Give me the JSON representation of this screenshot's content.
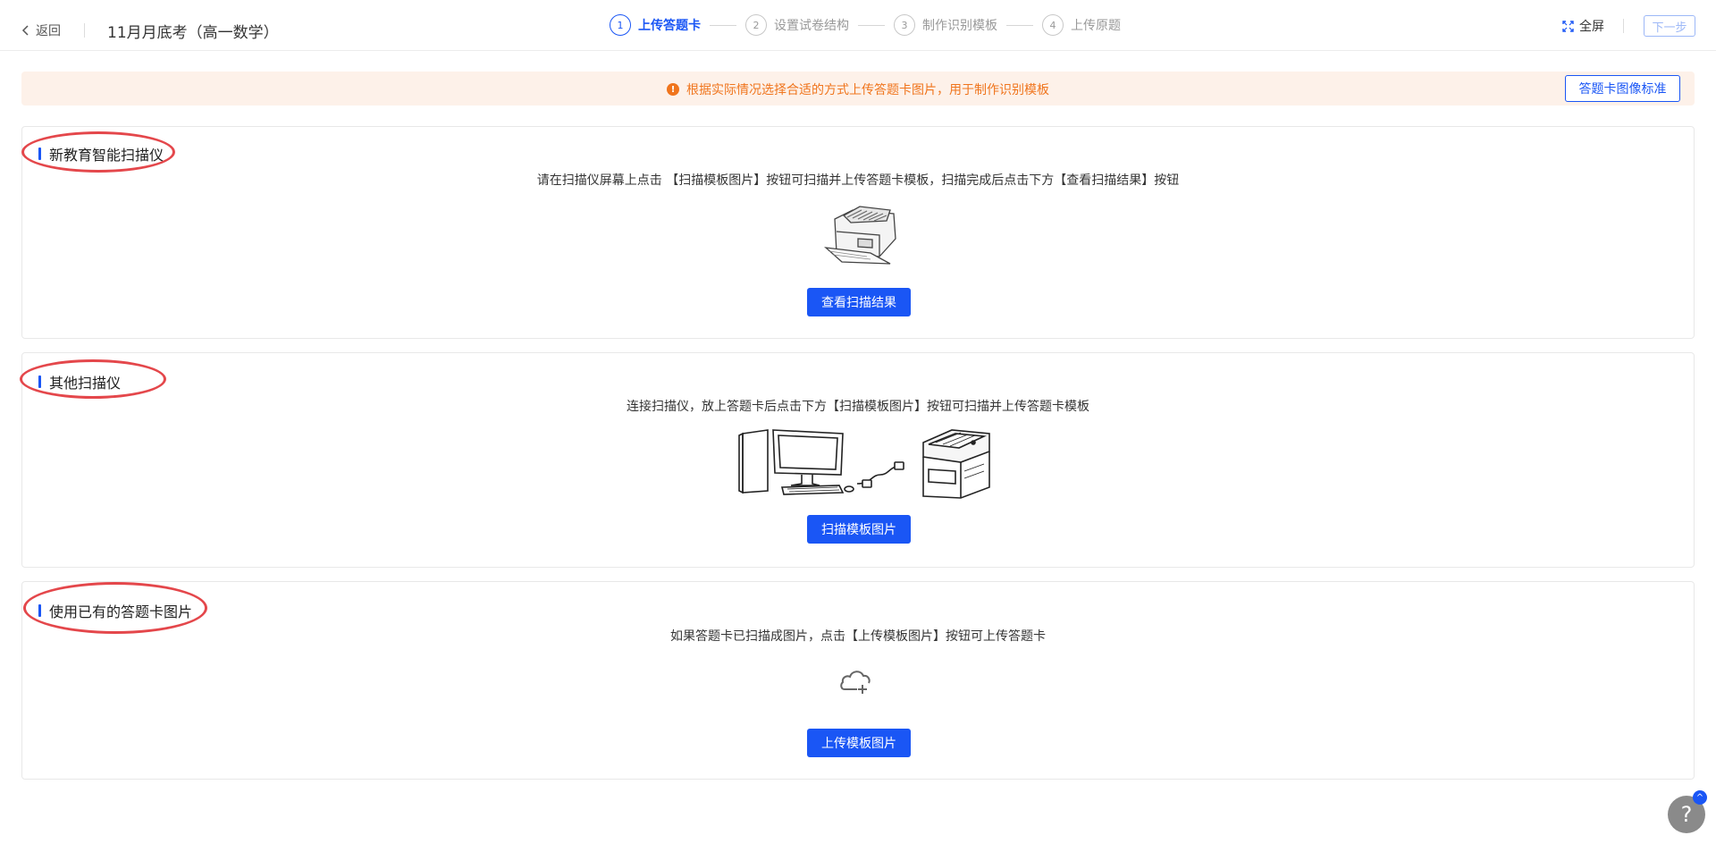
{
  "header": {
    "back_label": "返回",
    "exam_title": "11月月底考（高一数学）",
    "steps": [
      {
        "num": "1",
        "label": "上传答题卡",
        "active": true
      },
      {
        "num": "2",
        "label": "设置试卷结构",
        "active": false
      },
      {
        "num": "3",
        "label": "制作识别模板",
        "active": false
      },
      {
        "num": "4",
        "label": "上传原题",
        "active": false
      }
    ],
    "fullscreen_label": "全屏",
    "next_label": "下一步"
  },
  "notice": {
    "text": "根据实际情况选择合适的方式上传答题卡图片，用于制作识别模板",
    "icon": "!",
    "standard_button": "答题卡图像标准"
  },
  "sections": [
    {
      "title": "新教育智能扫描仪",
      "desc": "请在扫描仪屏幕上点击 【扫描模板图片】按钮可扫描并上传答题卡模板，扫描完成后点击下方【查看扫描结果】按钮",
      "button": "查看扫描结果",
      "image": "scanner-icon"
    },
    {
      "title": "其他扫描仪",
      "desc": "连接扫描仪，放上答题卡后点击下方【扫描模板图片】按钮可扫描并上传答题卡模板",
      "button": "扫描模板图片",
      "image": "computer-scanner-icon"
    },
    {
      "title": "使用已有的答题卡图片",
      "desc": "如果答题卡已扫描成图片，点击【上传模板图片】按钮可上传答题卡",
      "button": "上传模板图片",
      "image": "cloud-upload-icon"
    }
  ],
  "help": {
    "label": "?",
    "badge": "^"
  },
  "colors": {
    "primary": "#1a56f5",
    "warning": "#f0751d",
    "notice_bg": "#fdf1e9",
    "annotation": "#e4474b"
  }
}
